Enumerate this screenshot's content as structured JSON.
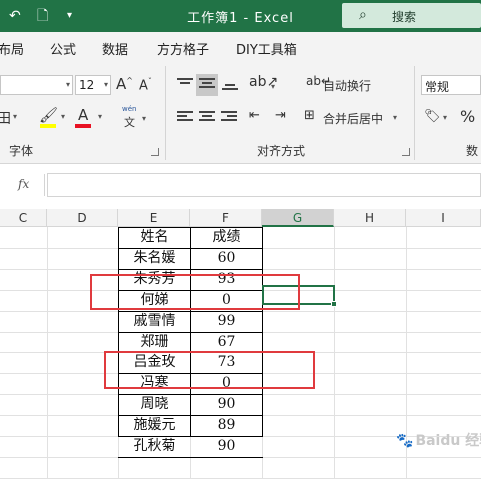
{
  "window": {
    "title": "工作簿1  -  Excel",
    "search_label": "搜索"
  },
  "tabs": [
    "布局",
    "公式",
    "数据",
    "方方格子",
    "DIY工具箱"
  ],
  "ribbon": {
    "font_size": "12",
    "grow_font": "A",
    "shrink_font": "A",
    "wen_label": "wén",
    "wen_char": "文",
    "wrap_text": "自动换行",
    "merge_center": "合并后居中",
    "number_format": "常规",
    "percent": "%",
    "group_font": "字体",
    "group_alignment": "对齐方式",
    "group_number": "数"
  },
  "formula_bar": {
    "fx": "fx",
    "value": ""
  },
  "columns": [
    "C",
    "D",
    "E",
    "F",
    "G",
    "H",
    "I"
  ],
  "active_column": "G",
  "table": {
    "headers": [
      "姓名",
      "成绩"
    ],
    "rows": [
      [
        "朱名媛",
        "60"
      ],
      [
        "朱秀芳",
        "93"
      ],
      [
        "何娣",
        "0"
      ],
      [
        "戚雪情",
        "99"
      ],
      [
        "郑珊",
        "67"
      ],
      [
        "吕金玫",
        "73"
      ],
      [
        "冯寒",
        "0"
      ],
      [
        "周晓",
        "90"
      ],
      [
        "施媛元",
        "89"
      ],
      [
        "孔秋菊",
        "90"
      ]
    ]
  },
  "colors": {
    "excel_green": "#217346",
    "highlight_red": "#e03a3e",
    "font_color_red": "#e81123",
    "fill_yellow": "#ffff00"
  },
  "watermark": "Baidu 经验"
}
